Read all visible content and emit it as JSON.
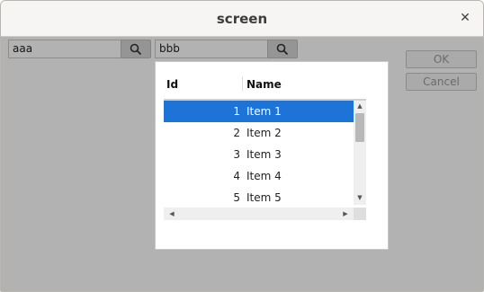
{
  "window": {
    "title": "screen",
    "close_icon": "close-icon"
  },
  "search1": {
    "value": "aaa"
  },
  "search2": {
    "value": "bbb"
  },
  "buttons": {
    "ok": "OK",
    "cancel": "Cancel"
  },
  "popup": {
    "columns": {
      "id": "Id",
      "name": "Name"
    },
    "rows": [
      {
        "id": "1",
        "name": "Item 1",
        "selected": true
      },
      {
        "id": "2",
        "name": "Item 2",
        "selected": false
      },
      {
        "id": "3",
        "name": "Item 3",
        "selected": false
      },
      {
        "id": "4",
        "name": "Item 4",
        "selected": false
      },
      {
        "id": "5",
        "name": "Item 5",
        "selected": false
      }
    ]
  },
  "colors": {
    "selection": "#1e74d6",
    "overlay": "rgba(0,0,0,0.30)"
  }
}
